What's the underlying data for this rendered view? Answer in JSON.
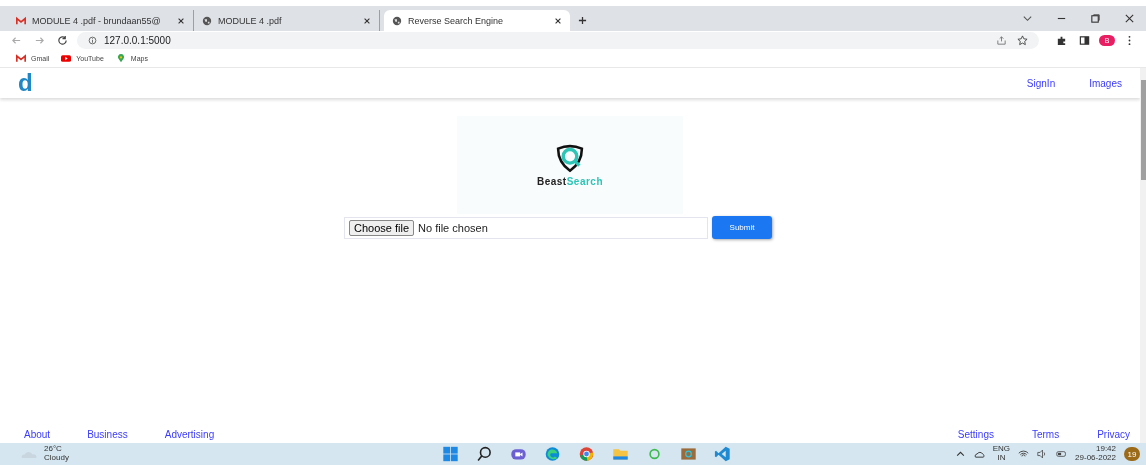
{
  "browser": {
    "tabs": [
      {
        "title": "MODULE 4 .pdf - brundaan55@",
        "kind": "mail",
        "selected": false
      },
      {
        "title": "MODULE 4 .pdf",
        "kind": "web",
        "selected": false
      },
      {
        "title": "Reverse Search Engine",
        "kind": "web",
        "selected": true
      }
    ],
    "address": "127.0.0.1:5000",
    "bookmarks": [
      {
        "label": "Gmail",
        "kind": "mail"
      },
      {
        "label": "YouTube",
        "kind": "video"
      },
      {
        "label": "Maps",
        "kind": "map"
      }
    ],
    "profile_initial": "B"
  },
  "navbar": {
    "logo": "d",
    "links": [
      "SignIn",
      "Images"
    ]
  },
  "brand": {
    "first": "Beast",
    "second": "Search"
  },
  "upload": {
    "choose_button": "Choose file",
    "status": "No file chosen",
    "submit": "Submit"
  },
  "footer": {
    "left_links": [
      "About",
      "Business",
      "Advertising"
    ],
    "right_links": [
      "Settings",
      "Terms",
      "Privacy"
    ]
  },
  "taskbar": {
    "weather": {
      "temp": "26°C",
      "condition": "Cloudy"
    },
    "apps": [
      {
        "kind": "start"
      },
      {
        "kind": "search"
      },
      {
        "kind": "chat"
      },
      {
        "kind": "edge"
      },
      {
        "kind": "chrome"
      },
      {
        "kind": "folder"
      },
      {
        "kind": "ring"
      },
      {
        "kind": "photo"
      },
      {
        "kind": "code"
      }
    ],
    "language": "ENG",
    "region": "IN",
    "time": "19:42",
    "date": "29-06-2022",
    "notifications": "19"
  }
}
